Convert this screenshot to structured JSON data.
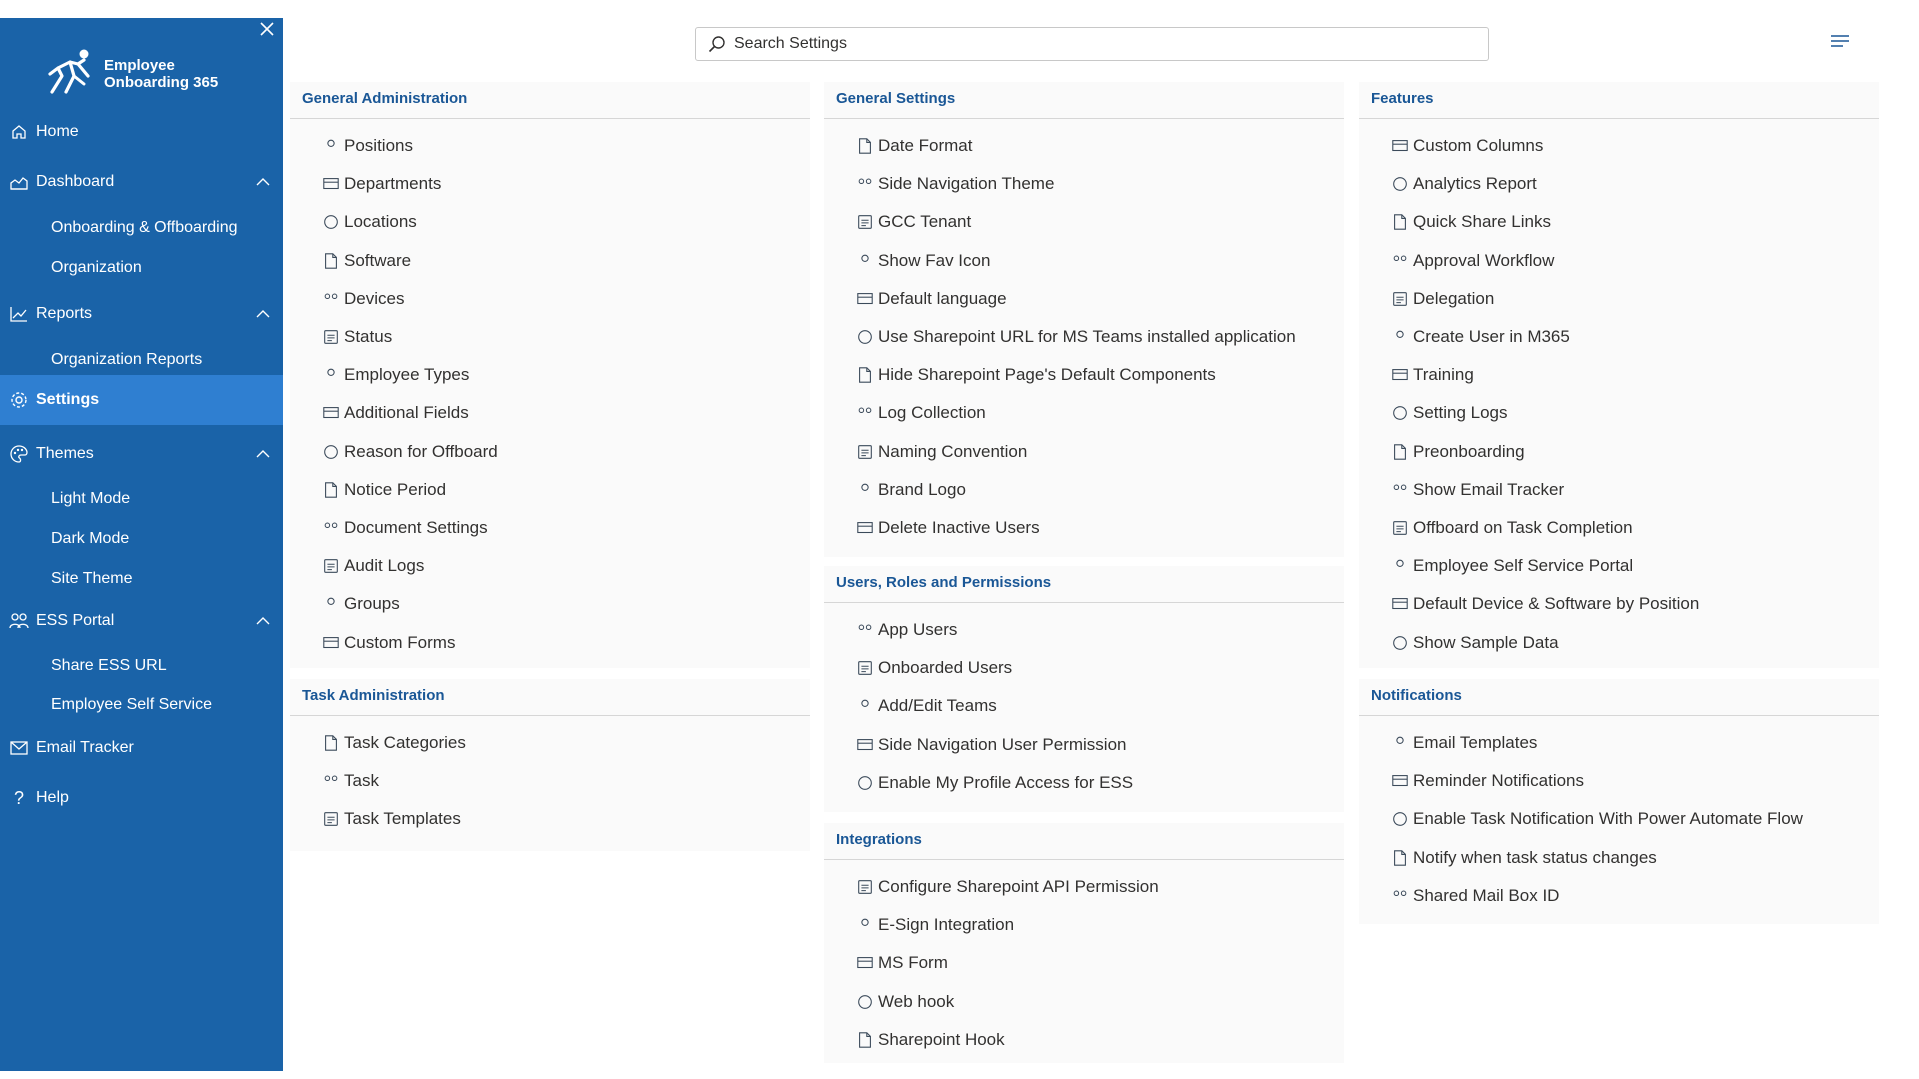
{
  "app": {
    "brand_line1": "Employee",
    "brand_line2": "Onboarding 365"
  },
  "search": {
    "placeholder": "Search Settings"
  },
  "sidebar": {
    "items": [
      {
        "label": "Home",
        "icon": "home-icon"
      },
      {
        "label": "Dashboard",
        "icon": "dashboard-icon",
        "children": [
          "Onboarding & Offboarding",
          "Organization"
        ]
      },
      {
        "label": "Reports",
        "icon": "reports-icon",
        "children": [
          "Organization Reports"
        ]
      },
      {
        "label": "Settings",
        "icon": "gear-icon",
        "active": true
      },
      {
        "label": "Themes",
        "icon": "palette-icon",
        "children": [
          "Light Mode",
          "Dark Mode",
          "Site Theme"
        ]
      },
      {
        "label": "ESS Portal",
        "icon": "people-icon",
        "children": [
          "Share ESS URL",
          "Employee Self Service"
        ]
      },
      {
        "label": "Email Tracker",
        "icon": "mail-tracker-icon"
      },
      {
        "label": "Help",
        "icon": "help-icon"
      }
    ]
  },
  "sections": {
    "general_admin": {
      "title": "General Administration",
      "items": [
        "Positions",
        "Departments",
        "Locations",
        "Software",
        "Devices",
        "Status",
        "Employee Types",
        "Additional Fields",
        "Reason for Offboard",
        "Notice Period",
        "Document Settings",
        "Audit Logs",
        "Groups",
        "Custom Forms"
      ]
    },
    "task_admin": {
      "title": "Task Administration",
      "items": [
        "Task Categories",
        "Task",
        "Task Templates"
      ]
    },
    "general_settings": {
      "title": "General Settings",
      "items": [
        "Date Format",
        "Side Navigation Theme",
        "GCC Tenant",
        "Show Fav Icon",
        "Default language",
        "Use Sharepoint URL for MS Teams installed application",
        "Hide Sharepoint Page's Default Components",
        "Log Collection",
        "Naming Convention",
        "Brand Logo",
        "Delete Inactive Users"
      ]
    },
    "users_roles": {
      "title": "Users, Roles and Permissions",
      "items": [
        "App Users",
        "Onboarded Users",
        "Add/Edit Teams",
        "Side Navigation User Permission",
        "Enable My Profile Access for ESS"
      ]
    },
    "integrations": {
      "title": "Integrations",
      "items": [
        "Configure Sharepoint API Permission",
        "E-Sign Integration",
        "MS Form",
        "Web hook",
        "Sharepoint Hook"
      ]
    },
    "features": {
      "title": "Features",
      "items": [
        "Custom Columns",
        "Analytics Report",
        "Quick Share Links",
        "Approval Workflow",
        "Delegation",
        "Create User in M365",
        "Training",
        "Setting Logs",
        "Preonboarding",
        "Show Email Tracker",
        "Offboard on Task Completion",
        "Employee Self Service Portal",
        "Default Device & Software by Position",
        "Show Sample Data"
      ]
    },
    "notifications": {
      "title": "Notifications",
      "items": [
        "Email Templates",
        "Reminder Notifications",
        "Enable Task Notification With Power Automate Flow",
        "Notify when task status changes",
        "Shared Mail Box ID"
      ]
    }
  },
  "colors": {
    "sidebar_bg": "#1a63a8",
    "sidebar_active": "#2f7fd1",
    "section_title": "#1a5796",
    "icon": "#3b4a5a"
  }
}
